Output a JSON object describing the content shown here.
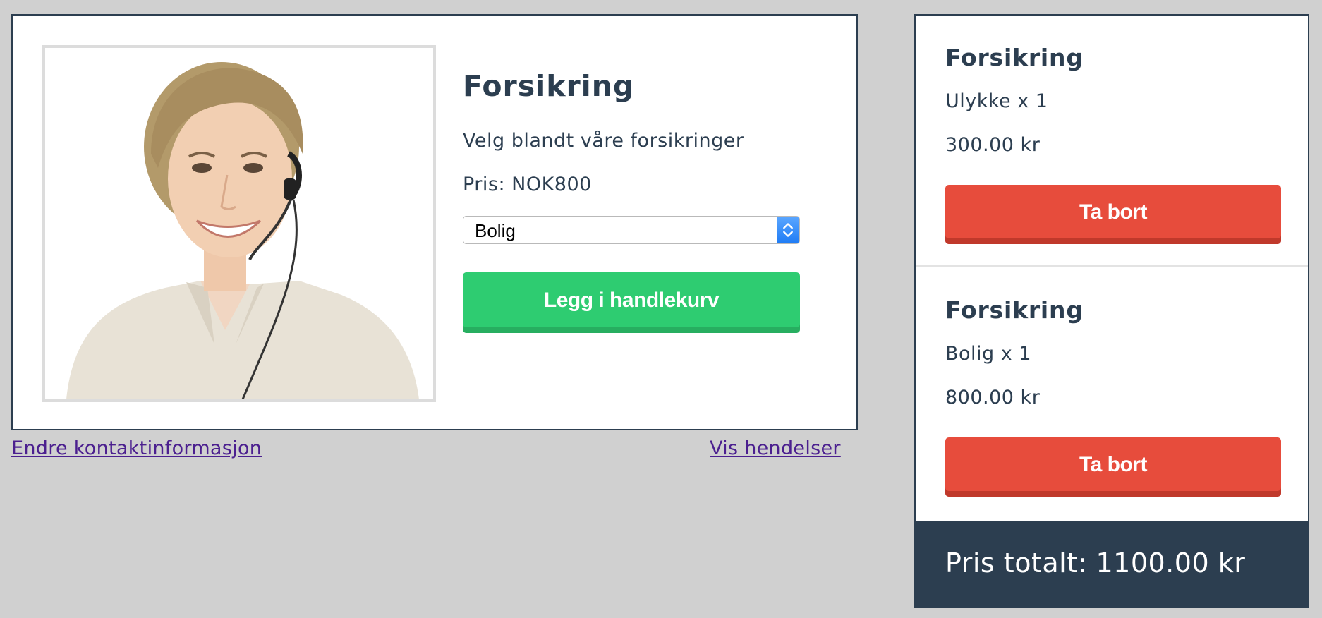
{
  "product": {
    "title": "Forsikring",
    "description": "Velg blandt våre forsikringer",
    "price_text": "Pris: NOK800",
    "selected_option": "Bolig",
    "add_button": "Legg i handlekurv"
  },
  "links": {
    "contact": "Endre kontaktinformasjon",
    "events": "Vis hendelser"
  },
  "cart": {
    "items": [
      {
        "title": "Forsikring",
        "quantity": "Ulykke x 1",
        "price": "300.00 kr",
        "remove_button": "Ta bort"
      },
      {
        "title": "Forsikring",
        "quantity": "Bolig x 1",
        "price": "800.00 kr",
        "remove_button": "Ta bort"
      }
    ],
    "total": "Pris totalt: 1100.00 kr"
  },
  "icons": {
    "photo": "support-agent-photo",
    "select_arrows": "chevron-up-down-icon"
  },
  "colors": {
    "page_bg": "#d0d0d0",
    "text_dark": "#2c3e50",
    "green": "#2ecc71",
    "red": "#e74c3c",
    "link": "#4b1f8f"
  }
}
